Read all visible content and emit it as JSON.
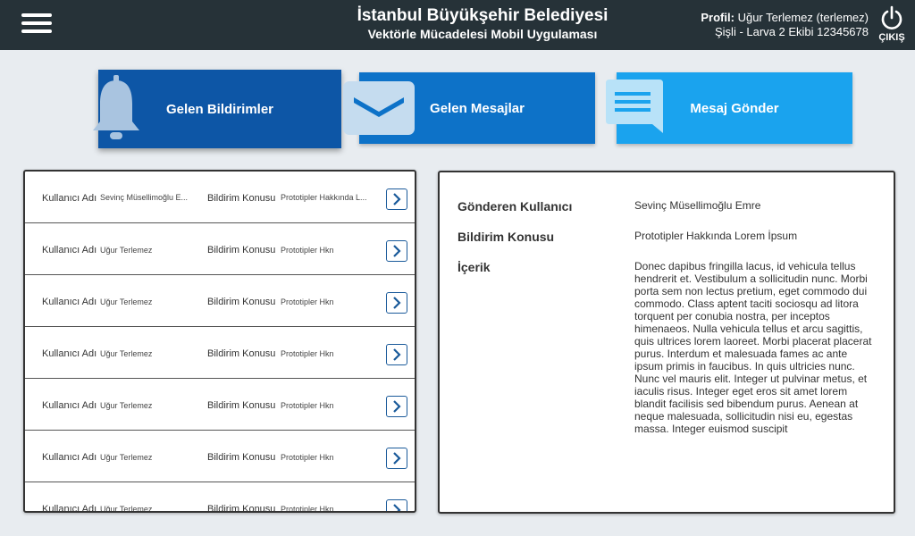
{
  "header": {
    "title": "İstanbul Büyükşehir Belediyesi",
    "subtitle": "Vektörle Mücadelesi Mobil Uygulaması",
    "profile_label": "Profil:",
    "profile_name": "Uğur Terlemez (terlemez)",
    "profile_team": "Şişli - Larva 2 Ekibi 12345678",
    "logout_label": "ÇIKIŞ"
  },
  "actions": [
    {
      "label": "Gelen Bildirimler",
      "icon": "bell-icon"
    },
    {
      "label": "Gelen Mesajlar",
      "icon": "envelope-icon"
    },
    {
      "label": "Mesaj Gönder",
      "icon": "chat-icon"
    }
  ],
  "list": {
    "user_label": "Kullanıcı Adı",
    "topic_label": "Bildirim Konusu",
    "rows": [
      {
        "user": "Sevinç Müsellimoğlu E...",
        "topic": "Prototipler Hakkında L..."
      },
      {
        "user": "Uğur Terlemez",
        "topic": "Prototipler Hkn"
      },
      {
        "user": "Uğur Terlemez",
        "topic": "Prototipler Hkn"
      },
      {
        "user": "Uğur Terlemez",
        "topic": "Prototipler Hkn"
      },
      {
        "user": "Uğur Terlemez",
        "topic": "Prototipler Hkn"
      },
      {
        "user": "Uğur Terlemez",
        "topic": "Prototipler Hkn"
      },
      {
        "user": "Uğur Terlemez",
        "topic": "Prototipler Hkn"
      }
    ]
  },
  "detail": {
    "sender_label": "Gönderen Kullanıcı",
    "sender_value": "Sevinç Müsellimoğlu Emre",
    "topic_label": "Bildirim Konusu",
    "topic_value": "Prototipler Hakkında Lorem İpsum",
    "content_label": "İçerik",
    "content_value": "Donec dapibus fringilla lacus, id vehicula tellus hendrerit et. Vestibulum a sollicitudin nunc. Morbi porta sem non lectus pretium, eget commodo dui commodo. Class aptent taciti sociosqu ad litora torquent per conubia nostra, per inceptos himenaeos. Nulla vehicula tellus et arcu sagittis, quis ultrices lorem laoreet. Morbi placerat placerat purus. Interdum et malesuada fames ac ante ipsum primis in faucibus. In quis ultricies nunc. Nunc vel mauris elit. Integer ut pulvinar metus, et iaculis risus. Integer eget eros sit amet lorem blandit facilisis sed bibendum purus. Aenean at neque malesuada, sollicitudin nisi eu, egestas massa. Integer euismod suscipit"
  }
}
